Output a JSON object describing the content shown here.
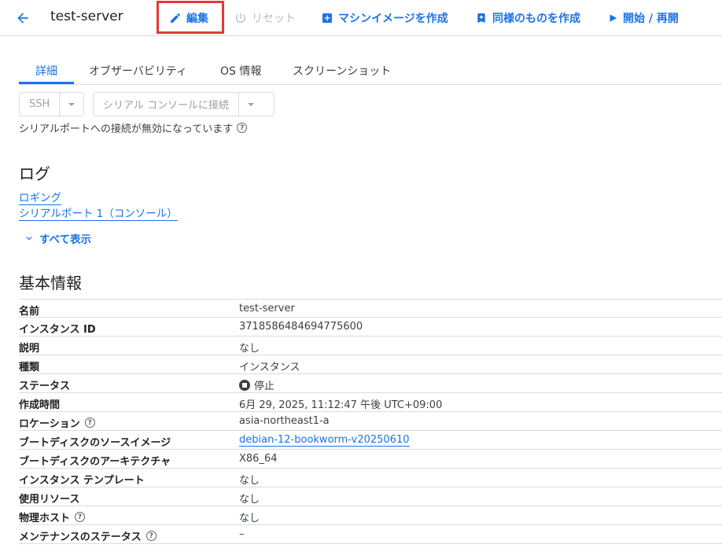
{
  "header": {
    "title": "test-server",
    "actions": {
      "edit": "編集",
      "reset": "リセット",
      "create_image": "マシンイメージを作成",
      "create_similar": "同様のものを作成",
      "start": "開始 / 再開"
    }
  },
  "tabs": [
    "詳細",
    "オブザーバビリティ",
    "OS 情報",
    "スクリーンショット"
  ],
  "connect": {
    "ssh": "SSH",
    "serial": "シリアル コンソールに接続",
    "note": "シリアルポートへの接続が無効になっています"
  },
  "logs": {
    "heading": "ログ",
    "logging": "ロギング",
    "serial_port": "シリアルポート 1（コンソール）",
    "show_all": "すべて表示"
  },
  "basic": {
    "heading": "基本情報",
    "rows": [
      {
        "key": "名前",
        "value": "test-server"
      },
      {
        "key": "インスタンス ID",
        "value": "3718586484694775600"
      },
      {
        "key": "説明",
        "value": "なし"
      },
      {
        "key": "種類",
        "value": "インスタンス"
      },
      {
        "key": "ステータス",
        "value": "停止"
      },
      {
        "key": "作成時間",
        "value": "6月 29, 2025, 11:12:47 午後 UTC+09:00"
      },
      {
        "key": "ロケーション",
        "value": "asia-northeast1-a"
      },
      {
        "key": "ブートディスクのソースイメージ",
        "value": "debian-12-bookworm-v20250610"
      },
      {
        "key": "ブートディスクのアーキテクチャ",
        "value": "X86_64"
      },
      {
        "key": "インスタンス テンプレート",
        "value": "なし"
      },
      {
        "key": "使用リソース",
        "value": "なし"
      },
      {
        "key": "物理ホスト",
        "value": "なし"
      },
      {
        "key": "メンテナンスのステータス",
        "value": "–"
      }
    ]
  },
  "colors": {
    "accent": "#1a73e8",
    "highlight": "#e53935",
    "disabled": "#b9bdc2"
  }
}
